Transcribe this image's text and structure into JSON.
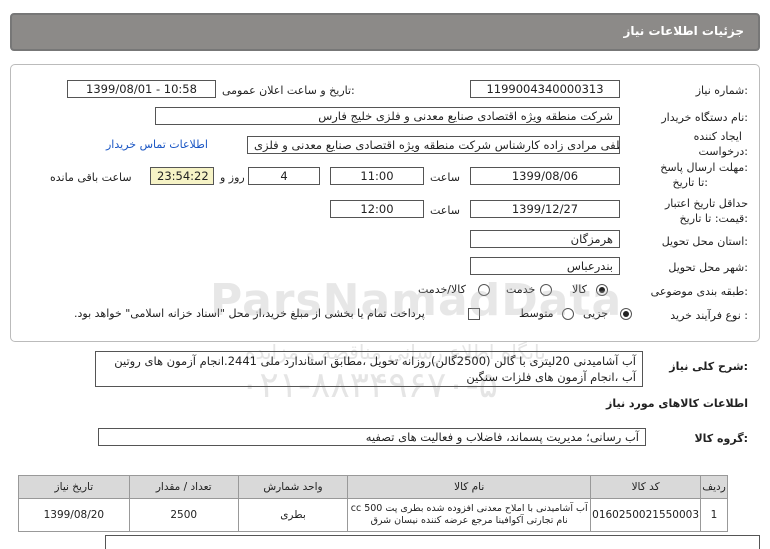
{
  "header": {
    "title": "جزئیات اطلاعات نیاز"
  },
  "fields": {
    "need_number_label": "شماره نیاز:",
    "need_number": "1199004340000313",
    "announce_label": "تاریخ و ساعت اعلان عمومی:",
    "announce_value": "1399/08/01 - 10:58",
    "buyer_label": "نام دستگاه خریدار:",
    "buyer_value": "شرکت منطقه ویژه اقتصادی صنایع معدنی و فلزی خلیج فارس",
    "creator_label_1": "ایجاد کننده",
    "creator_label_2": "درخواست:",
    "creator_value": "مصطفی مرادی زاده کارشناس شرکت منطقه ویژه اقتصادی صنایع معدنی و فلزی",
    "contact_link": "اطلاعات تماس خریدار",
    "deadline_label_1": "مهلت ارسال پاسخ:",
    "deadline_label_2": "تا تاریخ:",
    "deadline_date": "1399/08/06",
    "time_label": "ساعت",
    "deadline_time": "11:00",
    "days_value": "4",
    "days_label": "روز و",
    "remaining_time": "23:54:22",
    "remaining_label": "ساعت باقی مانده",
    "validity_label_1": "حداقل تاریخ اعتبار",
    "validity_label_2": "قیمت: تا تاریخ:",
    "validity_date": "1399/12/27",
    "validity_time": "12:00",
    "province_label": "استان محل تحویل:",
    "province_value": "هرمزگان",
    "city_label": "شهر محل تحویل:",
    "city_value": "بندرعباس",
    "category_label": "طبقه بندی موضوعی:",
    "category_options": [
      "کالا",
      "خدمت",
      "کالا/خدمت"
    ],
    "process_label": "نوع فرآیند خرید :",
    "process_options": [
      "جزیی",
      "متوسط"
    ],
    "payment_note": "پرداخت تمام یا بخشی از مبلغ خرید،از محل \"اسناد خزانه اسلامی\" خواهد بود."
  },
  "watermark": {
    "line1": "ParsNamadData",
    "line2": "پایگاه اطلاع رسانی مناقصه و مزایده",
    "line3": "۰۲۱-۸۸۳۴۹۶۷۰-۵"
  },
  "description": {
    "label": "شرح کلی نیاز:",
    "text": "آب آشامیدنی 20لیتری با گالن (2500گالن)روزانه تحویل ،مطابق استاندارد ملی 2441.انجام آزمون های روتین آب ،انجام آزمون های فلزات سنگین"
  },
  "goods_info": {
    "title": "اطلاعات کالاهای مورد نیاز"
  },
  "goods_group": {
    "label": "گروه کالا:",
    "value": "آب رسانی؛ مدیریت پسماند، فاضلاب و فعالیت های تصفیه"
  },
  "table": {
    "headers": [
      "ردیف",
      "کد کالا",
      "نام کالا",
      "واحد شمارش",
      "تعداد / مقدار",
      "تاریخ نیاز"
    ],
    "rows": [
      {
        "row": "1",
        "code": "0160250021550003",
        "name_1": "آب آشامیدنی با املاح معدنی افزوده شده بطری پت 500 cc",
        "name_2": "نام تجارتی آکوافینا مرجع عرضه کننده نیسان شرق",
        "unit": "بطری",
        "qty": "2500",
        "date": "1399/08/20"
      }
    ]
  }
}
